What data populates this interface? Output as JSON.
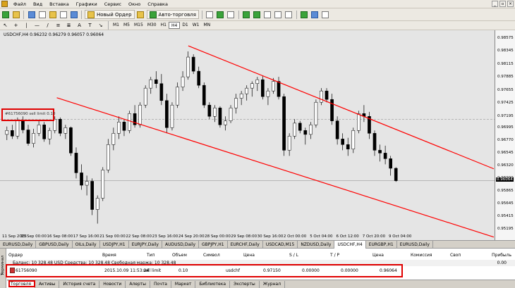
{
  "menu": [
    "Файл",
    "Вид",
    "Вставка",
    "Графики",
    "Сервис",
    "Окно",
    "Справка"
  ],
  "toolbar": {
    "new_order_label": "Новый Ордер",
    "auto_trading_label": "Авто-торговля",
    "timeframes": [
      "M1",
      "M5",
      "M15",
      "M30",
      "H1",
      "H4",
      "D1",
      "W1",
      "MN"
    ],
    "active_timeframe": "H4"
  },
  "chart": {
    "title": "USDCHF,H4  0.96232 0.96279 0.96057 0.96064",
    "order_line_label": "#61756090 sell limit 0.10",
    "current_price_label": "0.96064",
    "y_ticks": [
      "0.98575",
      "0.98345",
      "0.98115",
      "0.97885",
      "0.97655",
      "0.97425",
      "0.97195",
      "0.96995",
      "0.96770",
      "0.96545",
      "0.96320",
      "0.96090",
      "0.95865",
      "0.95645",
      "0.95415",
      "0.95195"
    ],
    "x_ticks": [
      "11 Sep 2015",
      "15 Sep 00:00",
      "16 Sep 08:00",
      "17 Sep 16:00",
      "21 Sep 00:00",
      "22 Sep 08:00",
      "23 Sep 16:00",
      "24 Sep 20:00",
      "28 Sep 00:00",
      "29 Sep 08:00",
      "30 Sep 16:00",
      "2 Oct 00:00",
      "5 Oct 04:00",
      "6 Oct 12:00",
      "7 Oct 20:00",
      "9 Oct 04:00"
    ],
    "colors": {
      "up": "#ffffff",
      "down": "#000000",
      "channel": "#ff0000",
      "bg": "#e5e5e5"
    }
  },
  "chart_data": {
    "type": "candlestick",
    "symbol": "USDCHF",
    "timeframe": "H4",
    "ylim": [
      0.9517,
      0.986
    ],
    "candles": [
      [
        0.9688,
        0.9702,
        0.9678,
        0.9695
      ],
      [
        0.9695,
        0.9705,
        0.968,
        0.9685
      ],
      [
        0.9685,
        0.9718,
        0.968,
        0.9712
      ],
      [
        0.9712,
        0.972,
        0.969,
        0.9696
      ],
      [
        0.9696,
        0.9705,
        0.9668,
        0.9672
      ],
      [
        0.9672,
        0.9698,
        0.9665,
        0.969
      ],
      [
        0.969,
        0.9712,
        0.9685,
        0.9705
      ],
      [
        0.9705,
        0.971,
        0.9675,
        0.968
      ],
      [
        0.968,
        0.97,
        0.967,
        0.9695
      ],
      [
        0.9695,
        0.972,
        0.969,
        0.9715
      ],
      [
        0.9715,
        0.9718,
        0.9685,
        0.969
      ],
      [
        0.969,
        0.9705,
        0.968,
        0.97
      ],
      [
        0.97,
        0.9702,
        0.965,
        0.9655
      ],
      [
        0.9655,
        0.9665,
        0.961,
        0.962
      ],
      [
        0.962,
        0.9635,
        0.959,
        0.9598
      ],
      [
        0.9598,
        0.9615,
        0.958,
        0.9605
      ],
      [
        0.9605,
        0.961,
        0.9545,
        0.9555
      ],
      [
        0.9555,
        0.958,
        0.953,
        0.9575
      ],
      [
        0.9575,
        0.963,
        0.957,
        0.9625
      ],
      [
        0.9625,
        0.968,
        0.962,
        0.967
      ],
      [
        0.967,
        0.97,
        0.966,
        0.969
      ],
      [
        0.969,
        0.972,
        0.968,
        0.971
      ],
      [
        0.971,
        0.9715,
        0.9685,
        0.9695
      ],
      [
        0.9695,
        0.973,
        0.969,
        0.9725
      ],
      [
        0.9725,
        0.974,
        0.97,
        0.9705
      ],
      [
        0.9705,
        0.9745,
        0.97,
        0.974
      ],
      [
        0.974,
        0.9775,
        0.9735,
        0.977
      ],
      [
        0.977,
        0.979,
        0.976,
        0.9785
      ],
      [
        0.9785,
        0.98,
        0.977,
        0.9778
      ],
      [
        0.9778,
        0.9795,
        0.974,
        0.9748
      ],
      [
        0.9748,
        0.976,
        0.969,
        0.97
      ],
      [
        0.97,
        0.9745,
        0.9695,
        0.974
      ],
      [
        0.974,
        0.978,
        0.9735,
        0.9772
      ],
      [
        0.9772,
        0.98,
        0.9765,
        0.979
      ],
      [
        0.979,
        0.9835,
        0.9785,
        0.9825
      ],
      [
        0.9825,
        0.983,
        0.9795,
        0.98
      ],
      [
        0.98,
        0.9808,
        0.977,
        0.9775
      ],
      [
        0.9775,
        0.978,
        0.9735,
        0.974
      ],
      [
        0.974,
        0.9745,
        0.9715,
        0.972
      ],
      [
        0.972,
        0.974,
        0.971,
        0.9735
      ],
      [
        0.9735,
        0.9738,
        0.97,
        0.9705
      ],
      [
        0.9705,
        0.972,
        0.9695,
        0.9712
      ],
      [
        0.9712,
        0.974,
        0.9708,
        0.9735
      ],
      [
        0.9735,
        0.976,
        0.9725,
        0.9752
      ],
      [
        0.9752,
        0.9765,
        0.974,
        0.976
      ],
      [
        0.976,
        0.9775,
        0.9748,
        0.977
      ],
      [
        0.977,
        0.9782,
        0.9755,
        0.9778
      ],
      [
        0.9778,
        0.979,
        0.9765,
        0.9785
      ],
      [
        0.9785,
        0.9792,
        0.975,
        0.9755
      ],
      [
        0.9755,
        0.977,
        0.974,
        0.9765
      ],
      [
        0.9765,
        0.9788,
        0.976,
        0.9782
      ],
      [
        0.9782,
        0.979,
        0.975,
        0.9755
      ],
      [
        0.9755,
        0.976,
        0.965,
        0.966
      ],
      [
        0.966,
        0.969,
        0.965,
        0.9685
      ],
      [
        0.9685,
        0.9715,
        0.968,
        0.9708
      ],
      [
        0.9708,
        0.9712,
        0.969,
        0.9695
      ],
      [
        0.9695,
        0.97,
        0.967,
        0.9688
      ],
      [
        0.9688,
        0.971,
        0.968,
        0.9705
      ],
      [
        0.9705,
        0.975,
        0.97,
        0.9745
      ],
      [
        0.9745,
        0.977,
        0.974,
        0.9765
      ],
      [
        0.9765,
        0.977,
        0.9745,
        0.975
      ],
      [
        0.975,
        0.976,
        0.9705,
        0.9712
      ],
      [
        0.9712,
        0.972,
        0.967,
        0.968
      ],
      [
        0.968,
        0.969,
        0.966,
        0.967
      ],
      [
        0.967,
        0.9682,
        0.965,
        0.9662
      ],
      [
        0.9662,
        0.97,
        0.9655,
        0.9695
      ],
      [
        0.9695,
        0.973,
        0.969,
        0.9725
      ],
      [
        0.9725,
        0.974,
        0.971,
        0.972
      ],
      [
        0.972,
        0.9728,
        0.968,
        0.969
      ],
      [
        0.969,
        0.9695,
        0.965,
        0.966
      ],
      [
        0.966,
        0.967,
        0.964,
        0.9655
      ],
      [
        0.9655,
        0.9668,
        0.9635,
        0.9645
      ],
      [
        0.9645,
        0.965,
        0.9615,
        0.9628
      ],
      [
        0.9628,
        0.963,
        0.9604,
        0.9606
      ]
    ],
    "channel_upper": {
      "start": [
        "24 Sep 20:00",
        0.9845
      ],
      "end": [
        "9 Oct 04:00",
        0.9695
      ]
    },
    "channel_lower": {
      "start": [
        "16 Sep 08:00",
        0.9753
      ],
      "end": [
        "9 Oct 04:00",
        0.956
      ]
    },
    "order_line_price": 0.9715,
    "current_price": 0.96064
  },
  "symbol_tabs": [
    "EURUSD,Daily",
    "GBPUSD,Daily",
    "OILs,Daily",
    "USDJPY,H1",
    "EURJPY,Daily",
    "AUDUSD,Daily",
    "GBPJPY,H1",
    "EURCHF,Daily",
    "USDCAD,M15",
    "NZDUSD,Daily",
    "USDCHF,H4",
    "EURGBP,H1",
    "EURUSD,Daily"
  ],
  "active_symbol_tab": "USDCHF,H4",
  "terminal": {
    "side_label": "Терминал",
    "headers": {
      "order": "Ордер",
      "time": "Время",
      "type": "Тип",
      "volume": "Объем",
      "symbol": "Символ",
      "price": "Цена",
      "sl": "S / L",
      "tp": "T / P",
      "price2": "Цена",
      "commission": "Комиссия",
      "swap": "Своп",
      "profit": "Прибыль"
    },
    "balance_text": "Баланс: 10 328.48 USD  Средства: 10 328.48  Свободная маржа: 10 328.48",
    "balance_profit": "0.00",
    "order_row": {
      "order": "61756090",
      "time": "2015.10.09 11:53:24",
      "type": "sell limit",
      "volume": "0.10",
      "symbol": "usdchf",
      "price": "0.97150",
      "sl": "0.00000",
      "tp": "0.00000",
      "price2": "0.96064"
    },
    "tabs": [
      "Торговля",
      "Активы",
      "История счета",
      "Новости",
      "Алерты",
      "Почта",
      "Маркет",
      "Библиотека",
      "Эксперты",
      "Журнал"
    ],
    "active_tab": "Торговля"
  }
}
